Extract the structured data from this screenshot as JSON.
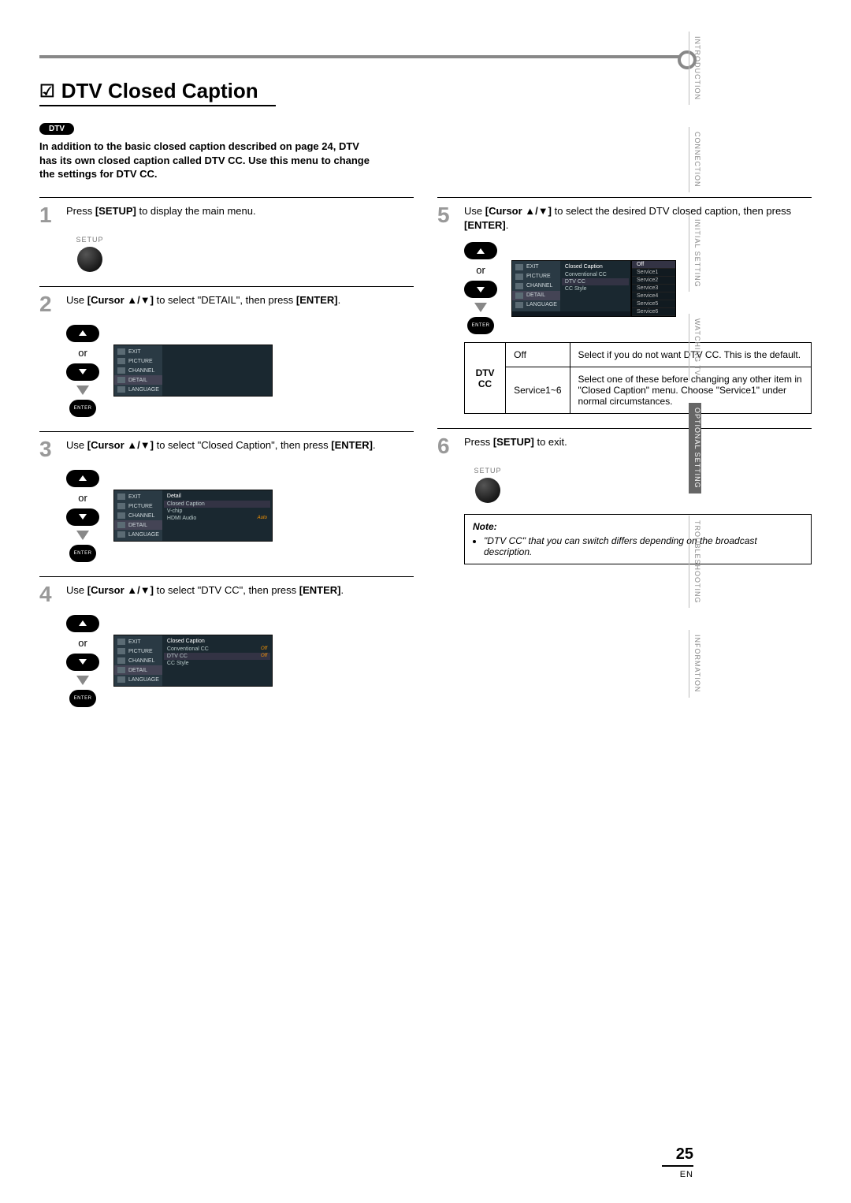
{
  "tabs": {
    "t1": "INTRODUCTION",
    "t2": "CONNECTION",
    "t3": "INITIAL SETTING",
    "t4": "WATCHING TV",
    "t5": "OPTIONAL SETTING",
    "t6": "TROUBLESHOOTING",
    "t7": "INFORMATION"
  },
  "heading": "DTV Closed Caption",
  "dtv_badge": "DTV",
  "intro": "In addition to the basic closed caption described on page 24, DTV has its own closed caption called DTV CC. Use this menu to change the settings for DTV CC.",
  "steps": {
    "s1": {
      "text_pre": "Press ",
      "bold": "[SETUP]",
      "text_post": " to display the main menu."
    },
    "s2": {
      "text_pre": "Use ",
      "bold": "[Cursor ▲/▼]",
      "text_mid": " to select \"DETAIL\", then press ",
      "bold2": "[ENTER]",
      "text_post": "."
    },
    "s3": {
      "text_pre": "Use ",
      "bold": "[Cursor ▲/▼]",
      "text_mid": " to select \"Closed Caption\", then press ",
      "bold2": "[ENTER]",
      "text_post": "."
    },
    "s4": {
      "text_pre": "Use ",
      "bold": "[Cursor ▲/▼]",
      "text_mid": " to select \"DTV CC\", then press ",
      "bold2": "[ENTER]",
      "text_post": "."
    },
    "s5": {
      "text_pre": "Use ",
      "bold": "[Cursor ▲/▼]",
      "text_mid": " to select the desired DTV closed caption, then press ",
      "bold2": "[ENTER]",
      "text_post": "."
    },
    "s6": {
      "text_pre": "Press ",
      "bold": "[SETUP]",
      "text_post": " to exit."
    }
  },
  "labels": {
    "setup": "SETUP",
    "enter": "ENTER",
    "or": "or"
  },
  "menu_side": {
    "exit": "EXIT",
    "picture": "PICTURE",
    "channel": "CHANNEL",
    "detail": "DETAIL",
    "language": "LANGUAGE"
  },
  "detail_menu": {
    "header": "Detail",
    "r1": "Closed Caption",
    "r2": "V-chip",
    "r3": "HDMI Audio",
    "r3v": "Auto"
  },
  "cc_menu": {
    "header": "Closed Caption",
    "r1": "Conventional CC",
    "r1v": "Off",
    "r2": "DTV CC",
    "r2v": "Off",
    "r3": "CC Style"
  },
  "dtvcc_options": {
    "o0": "Off",
    "o1": "Service1",
    "o2": "Service2",
    "o3": "Service3",
    "o4": "Service4",
    "o5": "Service5",
    "o6": "Service6"
  },
  "table": {
    "rowhead": "DTV CC",
    "c1a": "Off",
    "c1b": "Select if you do not want DTV CC. This is the default.",
    "c2a": "Service1~6",
    "c2b": "Select one of these before changing any other item in \"Closed Caption\" menu. Choose \"Service1\" under normal circumstances."
  },
  "note": {
    "header": "Note:",
    "li1": "\"DTV CC\" that you can switch differs depending on the broadcast description."
  },
  "page_number": "25",
  "page_en": "EN"
}
